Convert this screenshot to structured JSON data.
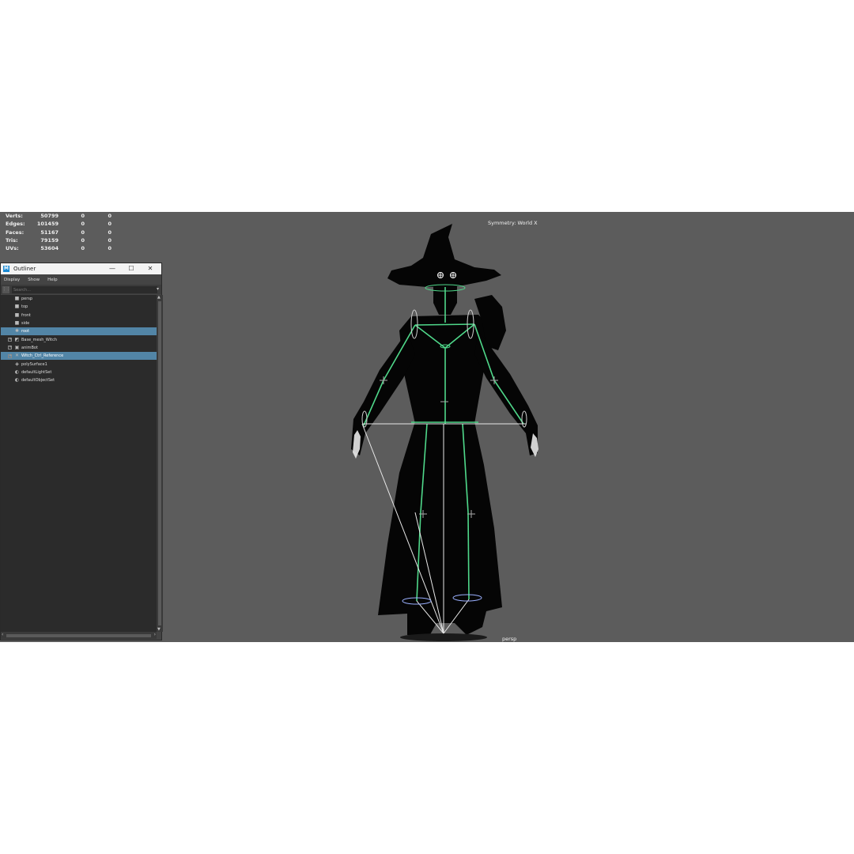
{
  "hud": {
    "rows": [
      {
        "label": "Verts:",
        "v1": "50799",
        "v2": "0",
        "v3": "0"
      },
      {
        "label": "Edges:",
        "v1": "101459",
        "v2": "0",
        "v3": "0"
      },
      {
        "label": "Faces:",
        "v1": "51167",
        "v2": "0",
        "v3": "0"
      },
      {
        "label": "Tris:",
        "v1": "79159",
        "v2": "0",
        "v3": "0"
      },
      {
        "label": "UVs:",
        "v1": "53604",
        "v2": "0",
        "v3": "0"
      }
    ]
  },
  "viewport": {
    "symmetry": "Symmetry: World X",
    "camera": "persp",
    "background_color": "#5c5c5c",
    "joint_color": "#4fd88a",
    "highlight_color": "#ffffff"
  },
  "outliner": {
    "title": "Outliner",
    "logo": "M",
    "menus": [
      "Display",
      "Show",
      "Help"
    ],
    "search_placeholder": "Search...",
    "items": [
      {
        "label": "persp",
        "icon": "camera-icon",
        "glyph": "■",
        "expandable": false,
        "selected": false
      },
      {
        "label": "top",
        "icon": "camera-icon",
        "glyph": "■",
        "expandable": false,
        "selected": false
      },
      {
        "label": "front",
        "icon": "camera-icon",
        "glyph": "■",
        "expandable": false,
        "selected": false
      },
      {
        "label": "side",
        "icon": "camera-icon",
        "glyph": "■",
        "expandable": false,
        "selected": false
      },
      {
        "label": "root",
        "icon": "joint-icon",
        "glyph": "✱",
        "expandable": false,
        "selected": true
      },
      {
        "label": "Base_mesh_Witch",
        "icon": "mesh-icon",
        "glyph": "◩",
        "expandable": true,
        "selected": false
      },
      {
        "label": "animBot",
        "icon": "group-icon",
        "glyph": "▣",
        "expandable": true,
        "selected": false
      },
      {
        "label": "Witch_Ctrl_Reference",
        "icon": "reference-icon",
        "glyph": "✕",
        "expandable": true,
        "selected": true
      },
      {
        "label": "polySurface1",
        "icon": "surface-icon",
        "glyph": "◈",
        "expandable": false,
        "selected": false
      },
      {
        "label": "defaultLightSet",
        "icon": "set-icon",
        "glyph": "◐",
        "expandable": false,
        "selected": false
      },
      {
        "label": "defaultObjectSet",
        "icon": "set-icon",
        "glyph": "◐",
        "expandable": false,
        "selected": false
      }
    ]
  }
}
